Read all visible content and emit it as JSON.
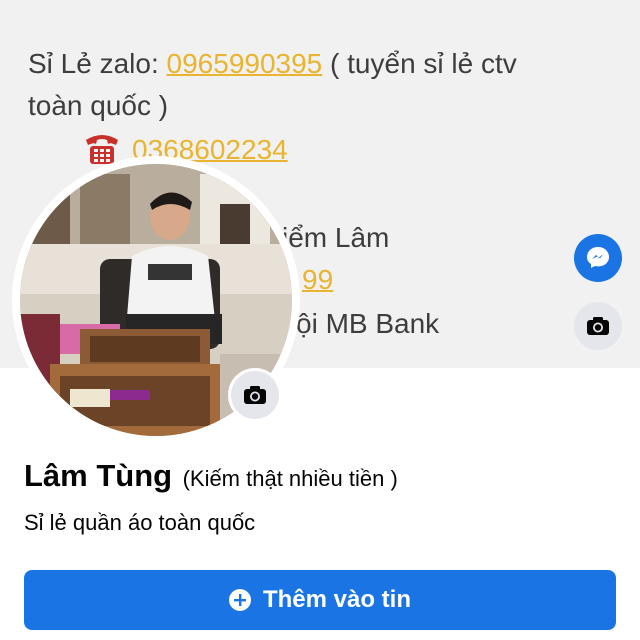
{
  "cover": {
    "line1_prefix": "Sỉ Lẻ zalo: ",
    "line1_phone": "0965990395",
    "line1_suffix": " ( tuyển sỉ lẻ ctv",
    "line2": "toàn quốc )",
    "line3_phone": "0368602234",
    "line4_partial": "iểm Lâm",
    "line5_partial": "99",
    "line6_partial": "ội MB Bank",
    "icons": [
      "telephone-icon",
      "messenger-icon",
      "camera-icon"
    ]
  },
  "profile": {
    "name": "Lâm Tùng",
    "nickname": "(Kiếm thật nhiều tiền )",
    "bio": "Sỉ lẻ quần áo toàn quốc"
  },
  "actions": {
    "add_story_label": "Thêm vào tin"
  },
  "colors": {
    "accent": "#1b74e4",
    "link": "#e9b42f",
    "cover_bg": "#f1f1f1"
  }
}
